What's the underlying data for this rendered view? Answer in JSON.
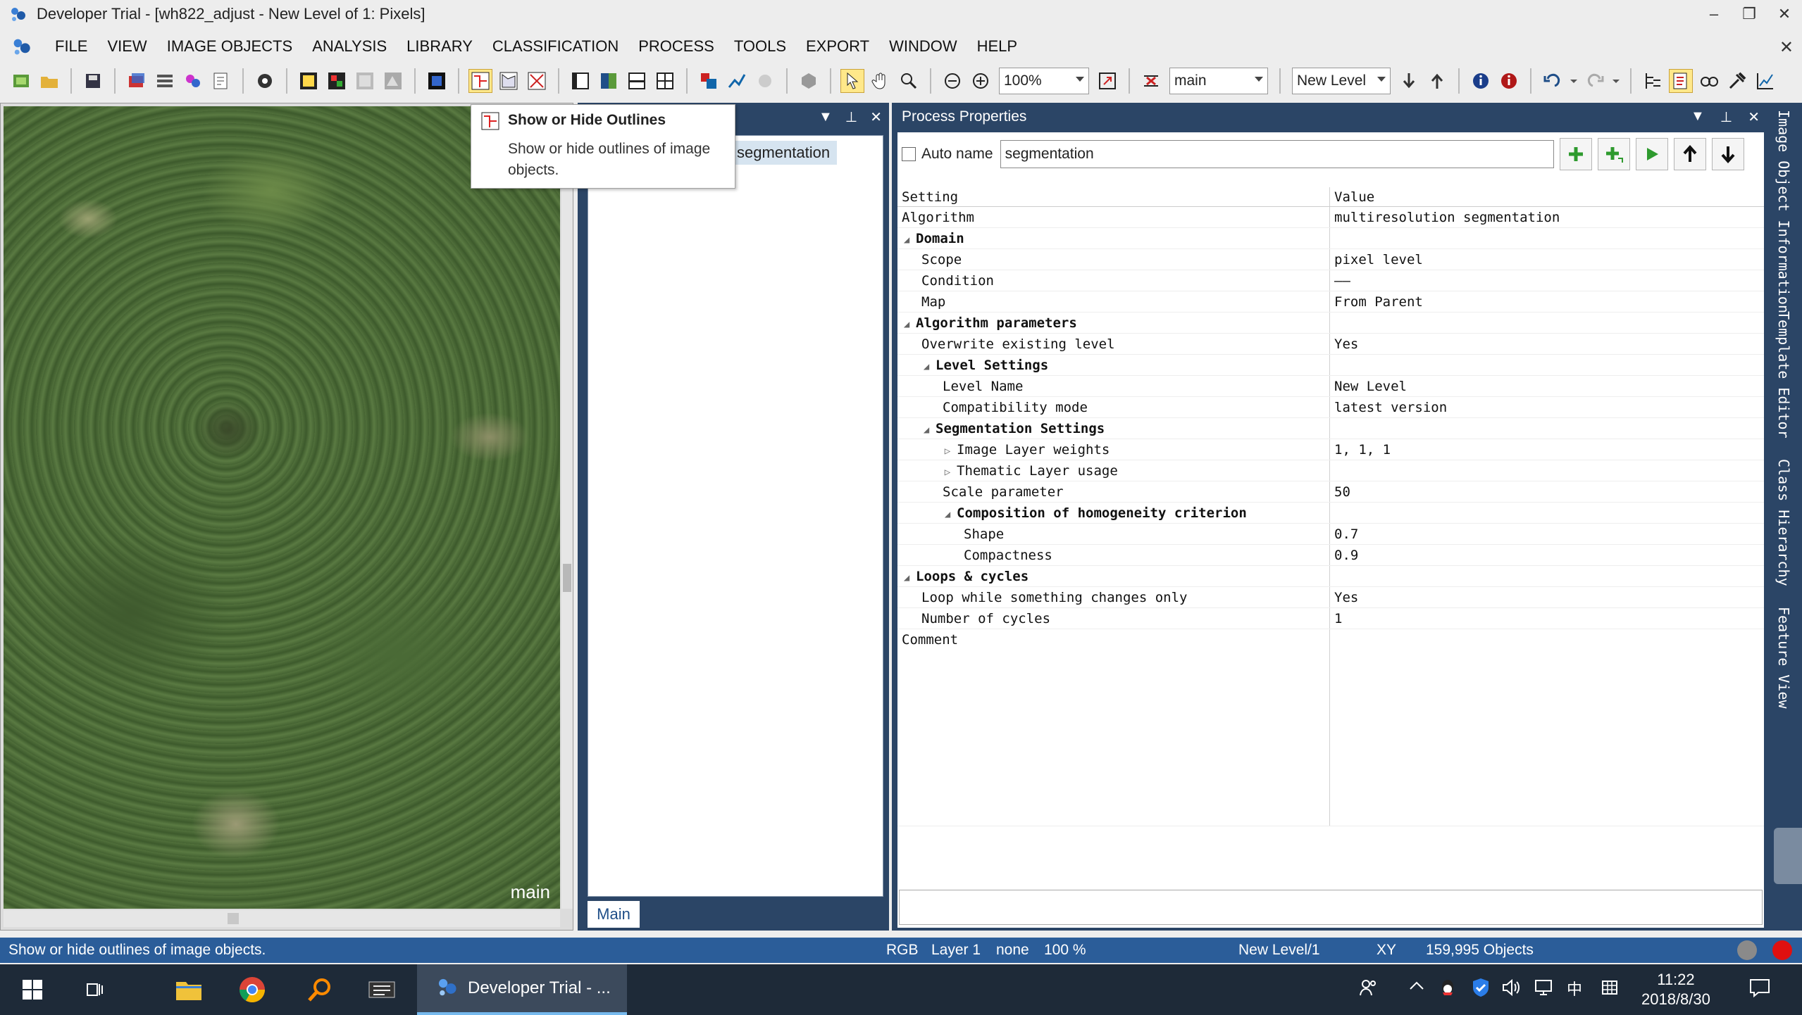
{
  "window": {
    "title": "Developer Trial - [wh822_adjust - New Level of 1: Pixels]",
    "controls": [
      "–",
      "❐",
      "✕"
    ]
  },
  "menu": {
    "items": [
      "FILE",
      "VIEW",
      "IMAGE OBJECTS",
      "ANALYSIS",
      "LIBRARY",
      "CLASSIFICATION",
      "PROCESS",
      "TOOLS",
      "EXPORT",
      "WINDOW",
      "HELP"
    ],
    "close": "✕"
  },
  "toolbar": {
    "zoom_value": "100%",
    "map_value": "main",
    "level_value": "New Level"
  },
  "image_view": {
    "label": "main"
  },
  "tooltip": {
    "title": "Show or Hide Outlines",
    "body": "Show or hide outlines of image objects."
  },
  "process_tree": {
    "item": "segmentation",
    "tab": "Main"
  },
  "process_properties": {
    "title": "Process Properties",
    "auto_name_label": "Auto name",
    "name_value": "segmentation",
    "col_setting": "Setting",
    "col_value": "Value",
    "rows": [
      {
        "setting": "Algorithm",
        "value": "multiresolution segmentation"
      },
      {
        "setting": "Domain",
        "value": ""
      },
      {
        "setting": "Scope",
        "value": "pixel level"
      },
      {
        "setting": "Condition",
        "value": "——"
      },
      {
        "setting": "Map",
        "value": "From Parent"
      },
      {
        "setting": "Algorithm parameters",
        "value": ""
      },
      {
        "setting": "Overwrite existing level",
        "value": "Yes"
      },
      {
        "setting": "Level Settings",
        "value": ""
      },
      {
        "setting": "Level Name",
        "value": "New Level"
      },
      {
        "setting": "Compatibility mode",
        "value": "latest version"
      },
      {
        "setting": "Segmentation Settings",
        "value": ""
      },
      {
        "setting": "Image Layer weights",
        "value": "1, 1, 1"
      },
      {
        "setting": "Thematic Layer usage",
        "value": ""
      },
      {
        "setting": "Scale parameter",
        "value": "50"
      },
      {
        "setting": "Composition of homogeneity criterion",
        "value": ""
      },
      {
        "setting": "Shape",
        "value": "0.7"
      },
      {
        "setting": "Compactness",
        "value": "0.9"
      },
      {
        "setting": "Loops & cycles",
        "value": ""
      },
      {
        "setting": "Loop while something changes only",
        "value": "Yes"
      },
      {
        "setting": "Number of cycles",
        "value": "1"
      },
      {
        "setting": "Comment",
        "value": ""
      }
    ]
  },
  "side_tabs": [
    "Image Object Information",
    "Template Editor",
    "Class Hierarchy",
    "Feature View"
  ],
  "status": {
    "message": "Show or hide outlines of image objects.",
    "mode": "RGB",
    "layer": "Layer 1",
    "none": "none",
    "zoom": "100 %",
    "level": "New Level/1",
    "xy": "XY",
    "objects": "159,995 Objects"
  },
  "taskbar": {
    "active_app": "Developer Trial - ...",
    "ime": "中",
    "time": "11:22",
    "date": "2018/8/30"
  }
}
